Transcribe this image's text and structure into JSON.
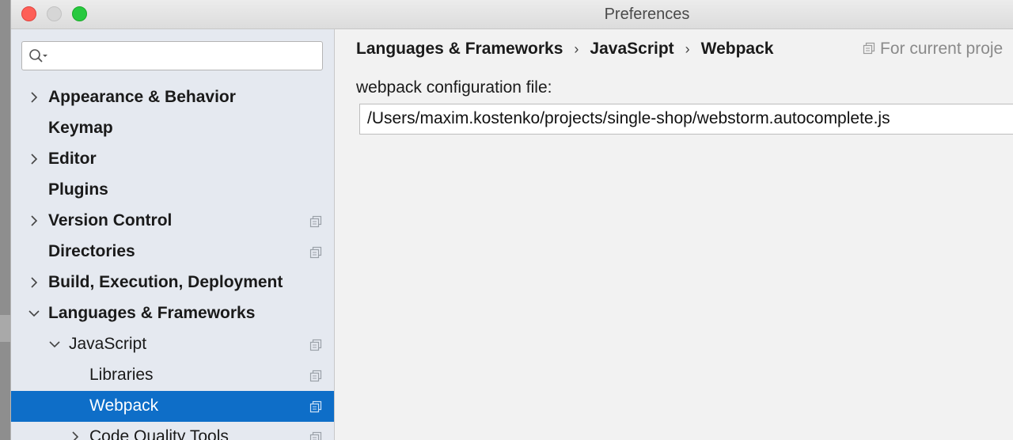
{
  "window": {
    "title": "Preferences"
  },
  "search": {
    "placeholder": ""
  },
  "sidebar": {
    "items": [
      {
        "label": "Appearance & Behavior",
        "bold": true,
        "chevron": "right",
        "project": false
      },
      {
        "label": "Keymap",
        "bold": true,
        "chevron": "none",
        "project": false
      },
      {
        "label": "Editor",
        "bold": true,
        "chevron": "right",
        "project": false
      },
      {
        "label": "Plugins",
        "bold": true,
        "chevron": "none",
        "project": false
      },
      {
        "label": "Version Control",
        "bold": true,
        "chevron": "right",
        "project": true
      },
      {
        "label": "Directories",
        "bold": true,
        "chevron": "none",
        "project": true
      },
      {
        "label": "Build, Execution, Deployment",
        "bold": true,
        "chevron": "right",
        "project": false
      },
      {
        "label": "Languages & Frameworks",
        "bold": true,
        "chevron": "down",
        "project": false
      },
      {
        "label": "JavaScript",
        "bold": false,
        "chevron": "down",
        "project": true
      },
      {
        "label": "Libraries",
        "bold": false,
        "chevron": "none",
        "project": true
      },
      {
        "label": "Webpack",
        "bold": false,
        "chevron": "none",
        "project": true,
        "selected": true
      },
      {
        "label": "Code Quality Tools",
        "bold": false,
        "chevron": "right",
        "project": true
      }
    ]
  },
  "breadcrumb": {
    "items": [
      "Languages & Frameworks",
      "JavaScript",
      "Webpack"
    ],
    "separator": "›"
  },
  "scope": {
    "label": "For current proje"
  },
  "webpack": {
    "config_label": "webpack configuration file:",
    "config_value": "/Users/maxim.kostenko/projects/single-shop/webstorm.autocomplete.js"
  },
  "colors": {
    "selection": "#0e6ec8",
    "sidebar_bg": "#e5e9f0",
    "close": "#fe5f57",
    "zoom": "#27c93f"
  },
  "icons": {
    "search": "search-icon",
    "project_scope": "project-scope-icon",
    "expand": "chevron-right-icon",
    "collapse": "chevron-down-icon"
  }
}
